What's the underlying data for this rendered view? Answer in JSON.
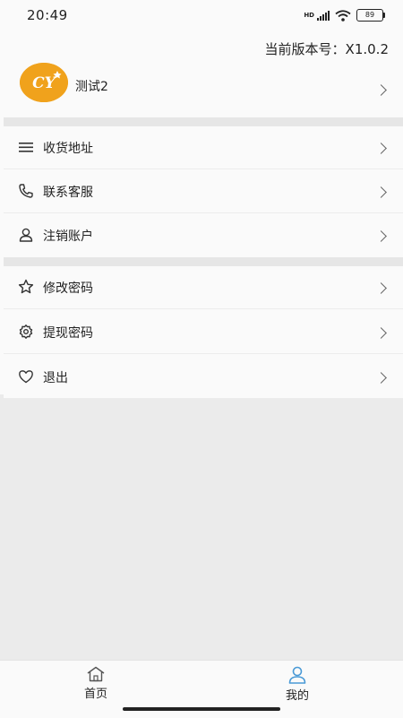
{
  "status_bar": {
    "time": "20:49",
    "network": "HD",
    "battery": "89"
  },
  "header": {
    "version": "当前版本号：X1.0.2"
  },
  "profile": {
    "name": "测试2",
    "avatar_text": "CY"
  },
  "menu_groups": [
    [
      {
        "label": "收货地址",
        "icon": "menu-lines-icon"
      },
      {
        "label": "联系客服",
        "icon": "phone-icon"
      },
      {
        "label": "注销账户",
        "icon": "user-icon"
      }
    ],
    [
      {
        "label": "修改密码",
        "icon": "star-icon"
      },
      {
        "label": "提现密码",
        "icon": "gear-icon"
      },
      {
        "label": "退出",
        "icon": "heart-icon"
      }
    ]
  ],
  "bottom_nav": [
    {
      "label": "首页",
      "icon": "home-icon",
      "active": false
    },
    {
      "label": "我的",
      "icon": "person-icon",
      "active": true
    }
  ],
  "colors": {
    "accent": "#4a9ad6",
    "avatar": "#f0a21c"
  }
}
